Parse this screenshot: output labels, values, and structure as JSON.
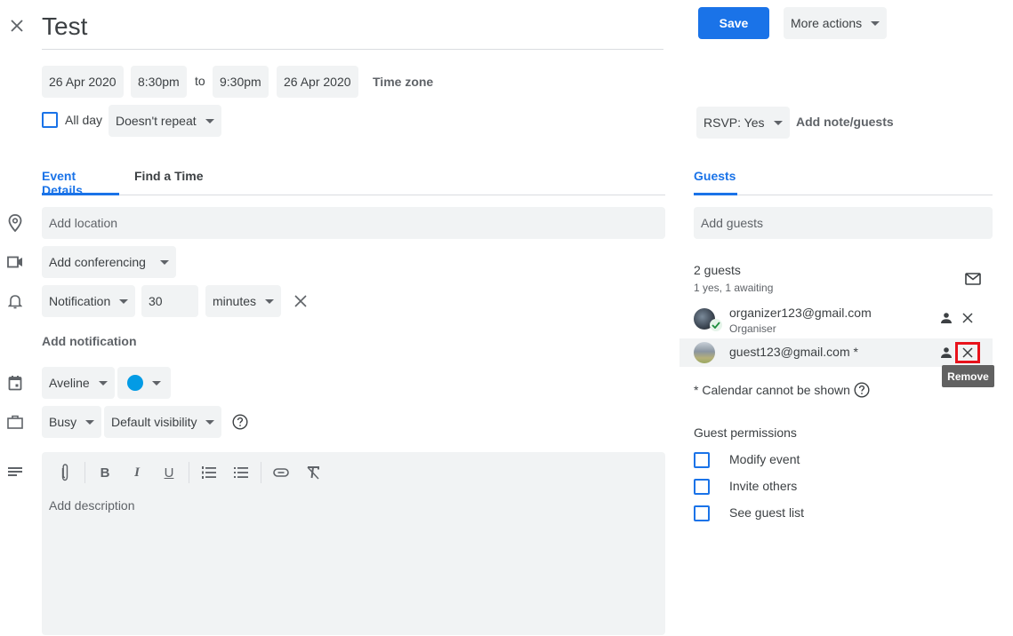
{
  "header": {
    "title": "Test",
    "save_label": "Save",
    "more_actions_label": "More actions"
  },
  "datetime": {
    "start_date": "26 Apr 2020",
    "start_time": "8:30pm",
    "to_label": "to",
    "end_time": "9:30pm",
    "end_date": "26 Apr 2020",
    "timezone_label": "Time zone",
    "all_day_label": "All day",
    "all_day_checked": false,
    "repeat_value": "Doesn't repeat"
  },
  "rsvp": {
    "value": "RSVP: Yes",
    "add_note_label": "Add note/guests"
  },
  "tabs": [
    {
      "label": "Event Details",
      "active": true
    },
    {
      "label": "Find a Time",
      "active": false
    }
  ],
  "details": {
    "location_placeholder": "Add location",
    "conferencing_label": "Add conferencing",
    "notification_type": "Notification",
    "notification_value": "30",
    "notification_unit": "minutes",
    "add_notification_label": "Add notification",
    "calendar_name": "Aveline",
    "calendar_color": "#039be5",
    "availability": "Busy",
    "visibility": "Default visibility",
    "description_placeholder": "Add description"
  },
  "guests_panel": {
    "tab_label": "Guests",
    "add_guests_placeholder": "Add guests",
    "count_label": "2 guests",
    "summary": "1 yes, 1 awaiting",
    "guests": [
      {
        "email": "organizer123@gmail.com",
        "role": "Organiser",
        "status": "yes"
      },
      {
        "email": "guest123@gmail.com *",
        "role": "",
        "status": "awaiting"
      }
    ],
    "remove_tooltip": "Remove",
    "calendar_note": "* Calendar cannot be shown",
    "permissions_title": "Guest permissions",
    "permissions": [
      {
        "label": "Modify event",
        "checked": false
      },
      {
        "label": "Invite others",
        "checked": false
      },
      {
        "label": "See guest list",
        "checked": false
      }
    ]
  },
  "colors": {
    "accent": "#1a73e8",
    "chip_bg": "#f1f3f4",
    "highlight_box": "#e8121b",
    "tooltip_bg": "#616161"
  }
}
